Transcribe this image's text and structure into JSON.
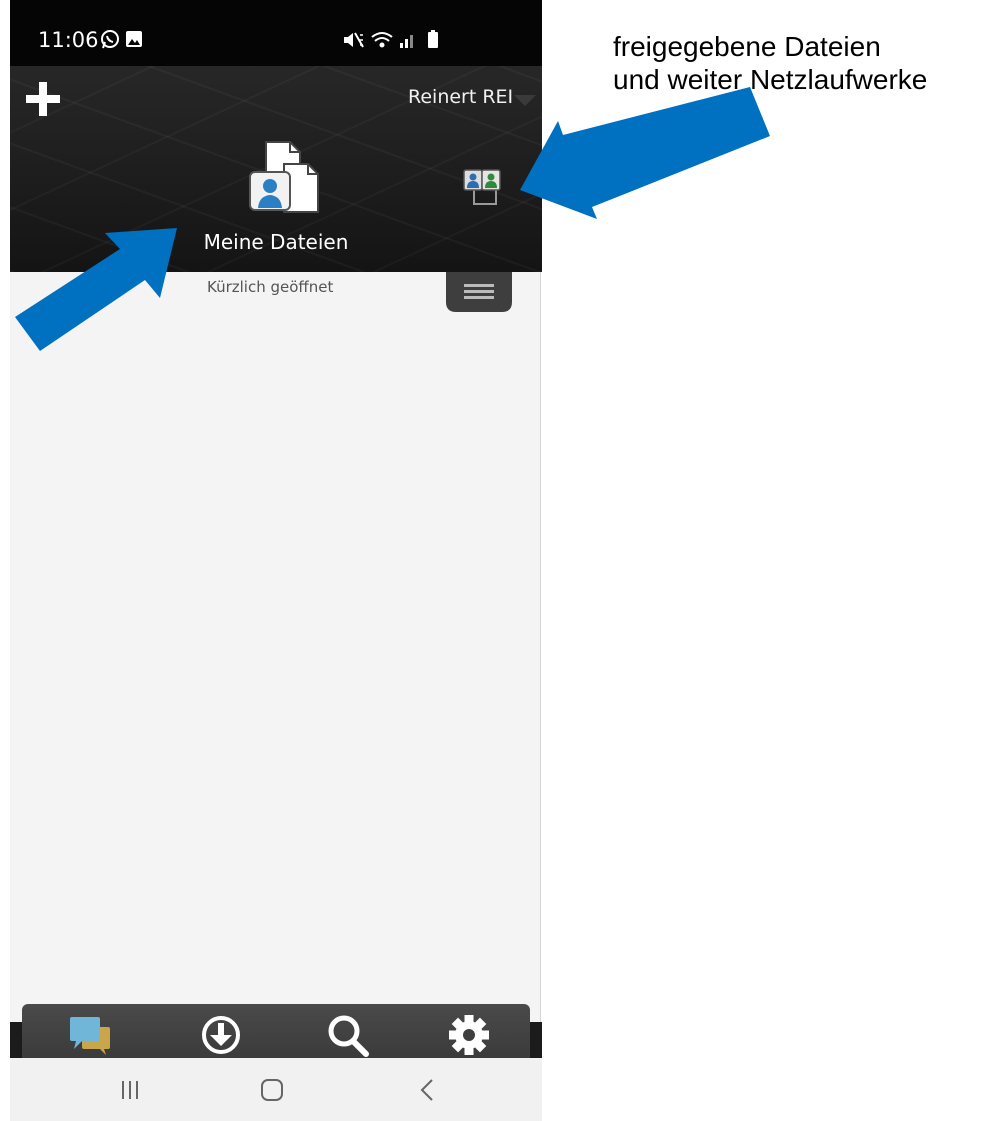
{
  "status_bar": {
    "time": "11:06",
    "icons_left": [
      "whatsapp-icon",
      "gallery-icon"
    ],
    "icons_right": [
      "mute-icon",
      "wifi-icon",
      "signal-icon",
      "battery-icon"
    ]
  },
  "header": {
    "account_name": "Reinert REI",
    "my_files_label": "Meine Dateien",
    "shared_icon": "shared-files-icon"
  },
  "content": {
    "recent_label": "Kürzlich geöffnet"
  },
  "toolbar": {
    "icons": [
      "messages-icon",
      "download-icon",
      "search-icon",
      "gear-icon"
    ]
  },
  "navbar": {
    "icons": [
      "recent-apps-icon",
      "home-icon",
      "back-icon"
    ]
  },
  "annotation": {
    "line1": "freigegebene Dateien",
    "line2": "und weiter Netzlaufwerke"
  },
  "colors": {
    "arrow": "#0070c0",
    "header_bg": "#1f1f1f",
    "content_bg": "#f4f4f4",
    "toolbar_bg": "#424242"
  }
}
